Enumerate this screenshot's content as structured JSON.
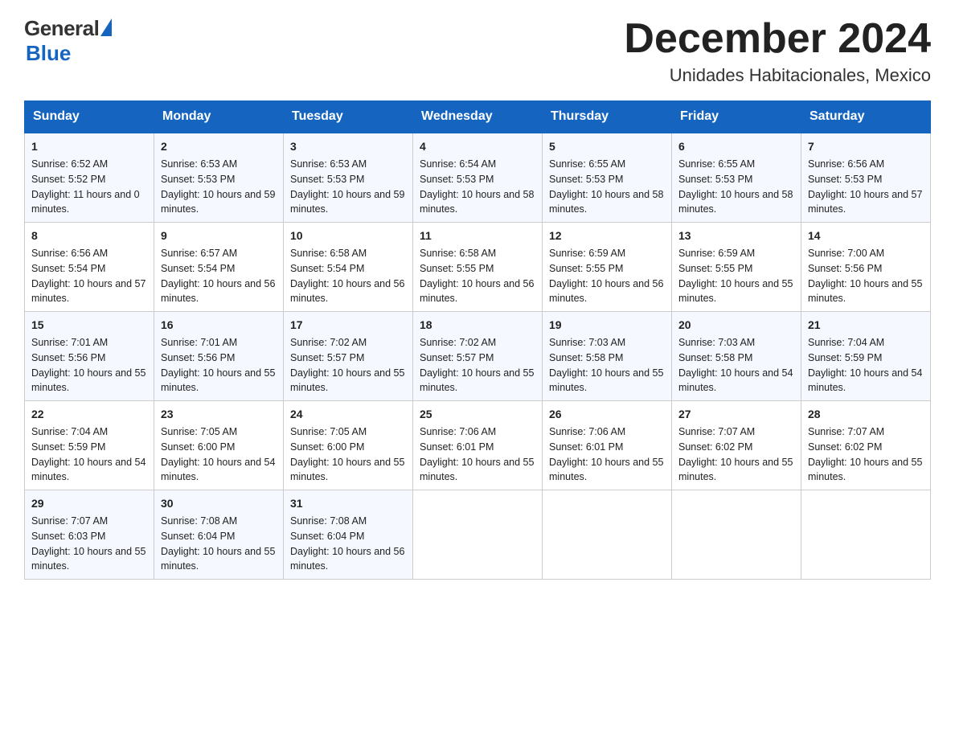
{
  "header": {
    "logo_general": "General",
    "logo_blue": "Blue",
    "month_year": "December 2024",
    "location": "Unidades Habitacionales, Mexico"
  },
  "days_of_week": [
    "Sunday",
    "Monday",
    "Tuesday",
    "Wednesday",
    "Thursday",
    "Friday",
    "Saturday"
  ],
  "weeks": [
    [
      {
        "day": "1",
        "sunrise": "6:52 AM",
        "sunset": "5:52 PM",
        "daylight": "11 hours and 0 minutes."
      },
      {
        "day": "2",
        "sunrise": "6:53 AM",
        "sunset": "5:53 PM",
        "daylight": "10 hours and 59 minutes."
      },
      {
        "day": "3",
        "sunrise": "6:53 AM",
        "sunset": "5:53 PM",
        "daylight": "10 hours and 59 minutes."
      },
      {
        "day": "4",
        "sunrise": "6:54 AM",
        "sunset": "5:53 PM",
        "daylight": "10 hours and 58 minutes."
      },
      {
        "day": "5",
        "sunrise": "6:55 AM",
        "sunset": "5:53 PM",
        "daylight": "10 hours and 58 minutes."
      },
      {
        "day": "6",
        "sunrise": "6:55 AM",
        "sunset": "5:53 PM",
        "daylight": "10 hours and 58 minutes."
      },
      {
        "day": "7",
        "sunrise": "6:56 AM",
        "sunset": "5:53 PM",
        "daylight": "10 hours and 57 minutes."
      }
    ],
    [
      {
        "day": "8",
        "sunrise": "6:56 AM",
        "sunset": "5:54 PM",
        "daylight": "10 hours and 57 minutes."
      },
      {
        "day": "9",
        "sunrise": "6:57 AM",
        "sunset": "5:54 PM",
        "daylight": "10 hours and 56 minutes."
      },
      {
        "day": "10",
        "sunrise": "6:58 AM",
        "sunset": "5:54 PM",
        "daylight": "10 hours and 56 minutes."
      },
      {
        "day": "11",
        "sunrise": "6:58 AM",
        "sunset": "5:55 PM",
        "daylight": "10 hours and 56 minutes."
      },
      {
        "day": "12",
        "sunrise": "6:59 AM",
        "sunset": "5:55 PM",
        "daylight": "10 hours and 56 minutes."
      },
      {
        "day": "13",
        "sunrise": "6:59 AM",
        "sunset": "5:55 PM",
        "daylight": "10 hours and 55 minutes."
      },
      {
        "day": "14",
        "sunrise": "7:00 AM",
        "sunset": "5:56 PM",
        "daylight": "10 hours and 55 minutes."
      }
    ],
    [
      {
        "day": "15",
        "sunrise": "7:01 AM",
        "sunset": "5:56 PM",
        "daylight": "10 hours and 55 minutes."
      },
      {
        "day": "16",
        "sunrise": "7:01 AM",
        "sunset": "5:56 PM",
        "daylight": "10 hours and 55 minutes."
      },
      {
        "day": "17",
        "sunrise": "7:02 AM",
        "sunset": "5:57 PM",
        "daylight": "10 hours and 55 minutes."
      },
      {
        "day": "18",
        "sunrise": "7:02 AM",
        "sunset": "5:57 PM",
        "daylight": "10 hours and 55 minutes."
      },
      {
        "day": "19",
        "sunrise": "7:03 AM",
        "sunset": "5:58 PM",
        "daylight": "10 hours and 55 minutes."
      },
      {
        "day": "20",
        "sunrise": "7:03 AM",
        "sunset": "5:58 PM",
        "daylight": "10 hours and 54 minutes."
      },
      {
        "day": "21",
        "sunrise": "7:04 AM",
        "sunset": "5:59 PM",
        "daylight": "10 hours and 54 minutes."
      }
    ],
    [
      {
        "day": "22",
        "sunrise": "7:04 AM",
        "sunset": "5:59 PM",
        "daylight": "10 hours and 54 minutes."
      },
      {
        "day": "23",
        "sunrise": "7:05 AM",
        "sunset": "6:00 PM",
        "daylight": "10 hours and 54 minutes."
      },
      {
        "day": "24",
        "sunrise": "7:05 AM",
        "sunset": "6:00 PM",
        "daylight": "10 hours and 55 minutes."
      },
      {
        "day": "25",
        "sunrise": "7:06 AM",
        "sunset": "6:01 PM",
        "daylight": "10 hours and 55 minutes."
      },
      {
        "day": "26",
        "sunrise": "7:06 AM",
        "sunset": "6:01 PM",
        "daylight": "10 hours and 55 minutes."
      },
      {
        "day": "27",
        "sunrise": "7:07 AM",
        "sunset": "6:02 PM",
        "daylight": "10 hours and 55 minutes."
      },
      {
        "day": "28",
        "sunrise": "7:07 AM",
        "sunset": "6:02 PM",
        "daylight": "10 hours and 55 minutes."
      }
    ],
    [
      {
        "day": "29",
        "sunrise": "7:07 AM",
        "sunset": "6:03 PM",
        "daylight": "10 hours and 55 minutes."
      },
      {
        "day": "30",
        "sunrise": "7:08 AM",
        "sunset": "6:04 PM",
        "daylight": "10 hours and 55 minutes."
      },
      {
        "day": "31",
        "sunrise": "7:08 AM",
        "sunset": "6:04 PM",
        "daylight": "10 hours and 56 minutes."
      },
      null,
      null,
      null,
      null
    ]
  ],
  "labels": {
    "sunrise": "Sunrise:",
    "sunset": "Sunset:",
    "daylight": "Daylight:"
  }
}
